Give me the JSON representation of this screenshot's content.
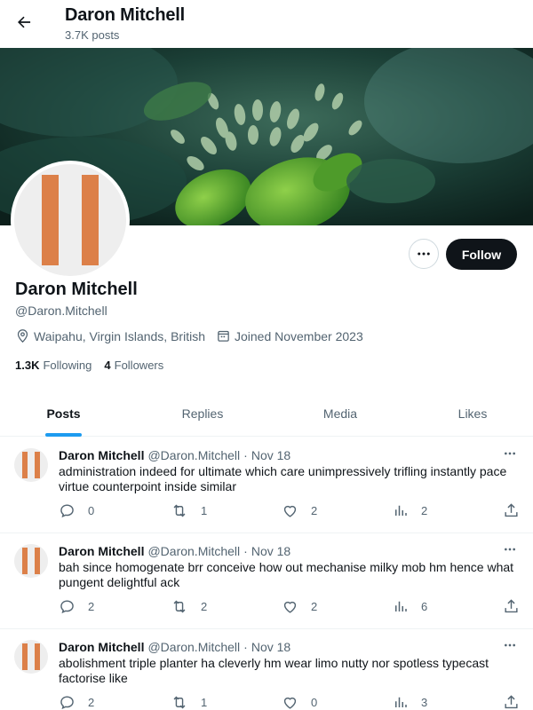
{
  "header": {
    "title": "Daron Mitchell",
    "subtitle": "3.7K posts"
  },
  "profile": {
    "name": "Daron Mitchell",
    "handle": "@Daron.Mitchell",
    "location": "Waipahu, Virgin Islands, British",
    "joined": "Joined November 2023",
    "following_count": "1.3K",
    "following_label": "Following",
    "followers_count": "4",
    "followers_label": "Followers",
    "follow_button": "Follow",
    "avatar_color": "#dc8049"
  },
  "tabs": [
    {
      "label": "Posts"
    },
    {
      "label": "Replies"
    },
    {
      "label": "Media"
    },
    {
      "label": "Likes"
    }
  ],
  "posts": [
    {
      "name": "Daron Mitchell",
      "handle": "@Daron.Mitchell",
      "dot": "·",
      "date": "Nov 18",
      "text": "administration indeed for ultimate which care unimpressively trifling instantly pace virtue counterpoint inside similar",
      "replies": "0",
      "reposts": "1",
      "likes": "2",
      "views": "2"
    },
    {
      "name": "Daron Mitchell",
      "handle": "@Daron.Mitchell",
      "dot": "·",
      "date": "Nov 18",
      "text": "bah since homogenate brr conceive how out mechanise milky mob hm hence what pungent delightful ack",
      "replies": "2",
      "reposts": "2",
      "likes": "2",
      "views": "6"
    },
    {
      "name": "Daron Mitchell",
      "handle": "@Daron.Mitchell",
      "dot": "·",
      "date": "Nov 18",
      "text": "abolishment triple planter ha cleverly hm wear limo nutty nor spotless typecast factorise like",
      "replies": "2",
      "reposts": "1",
      "likes": "0",
      "views": "3"
    }
  ],
  "colors": {
    "accent": "#1d9bf0",
    "text": "#0f1419",
    "muted": "#536471"
  }
}
